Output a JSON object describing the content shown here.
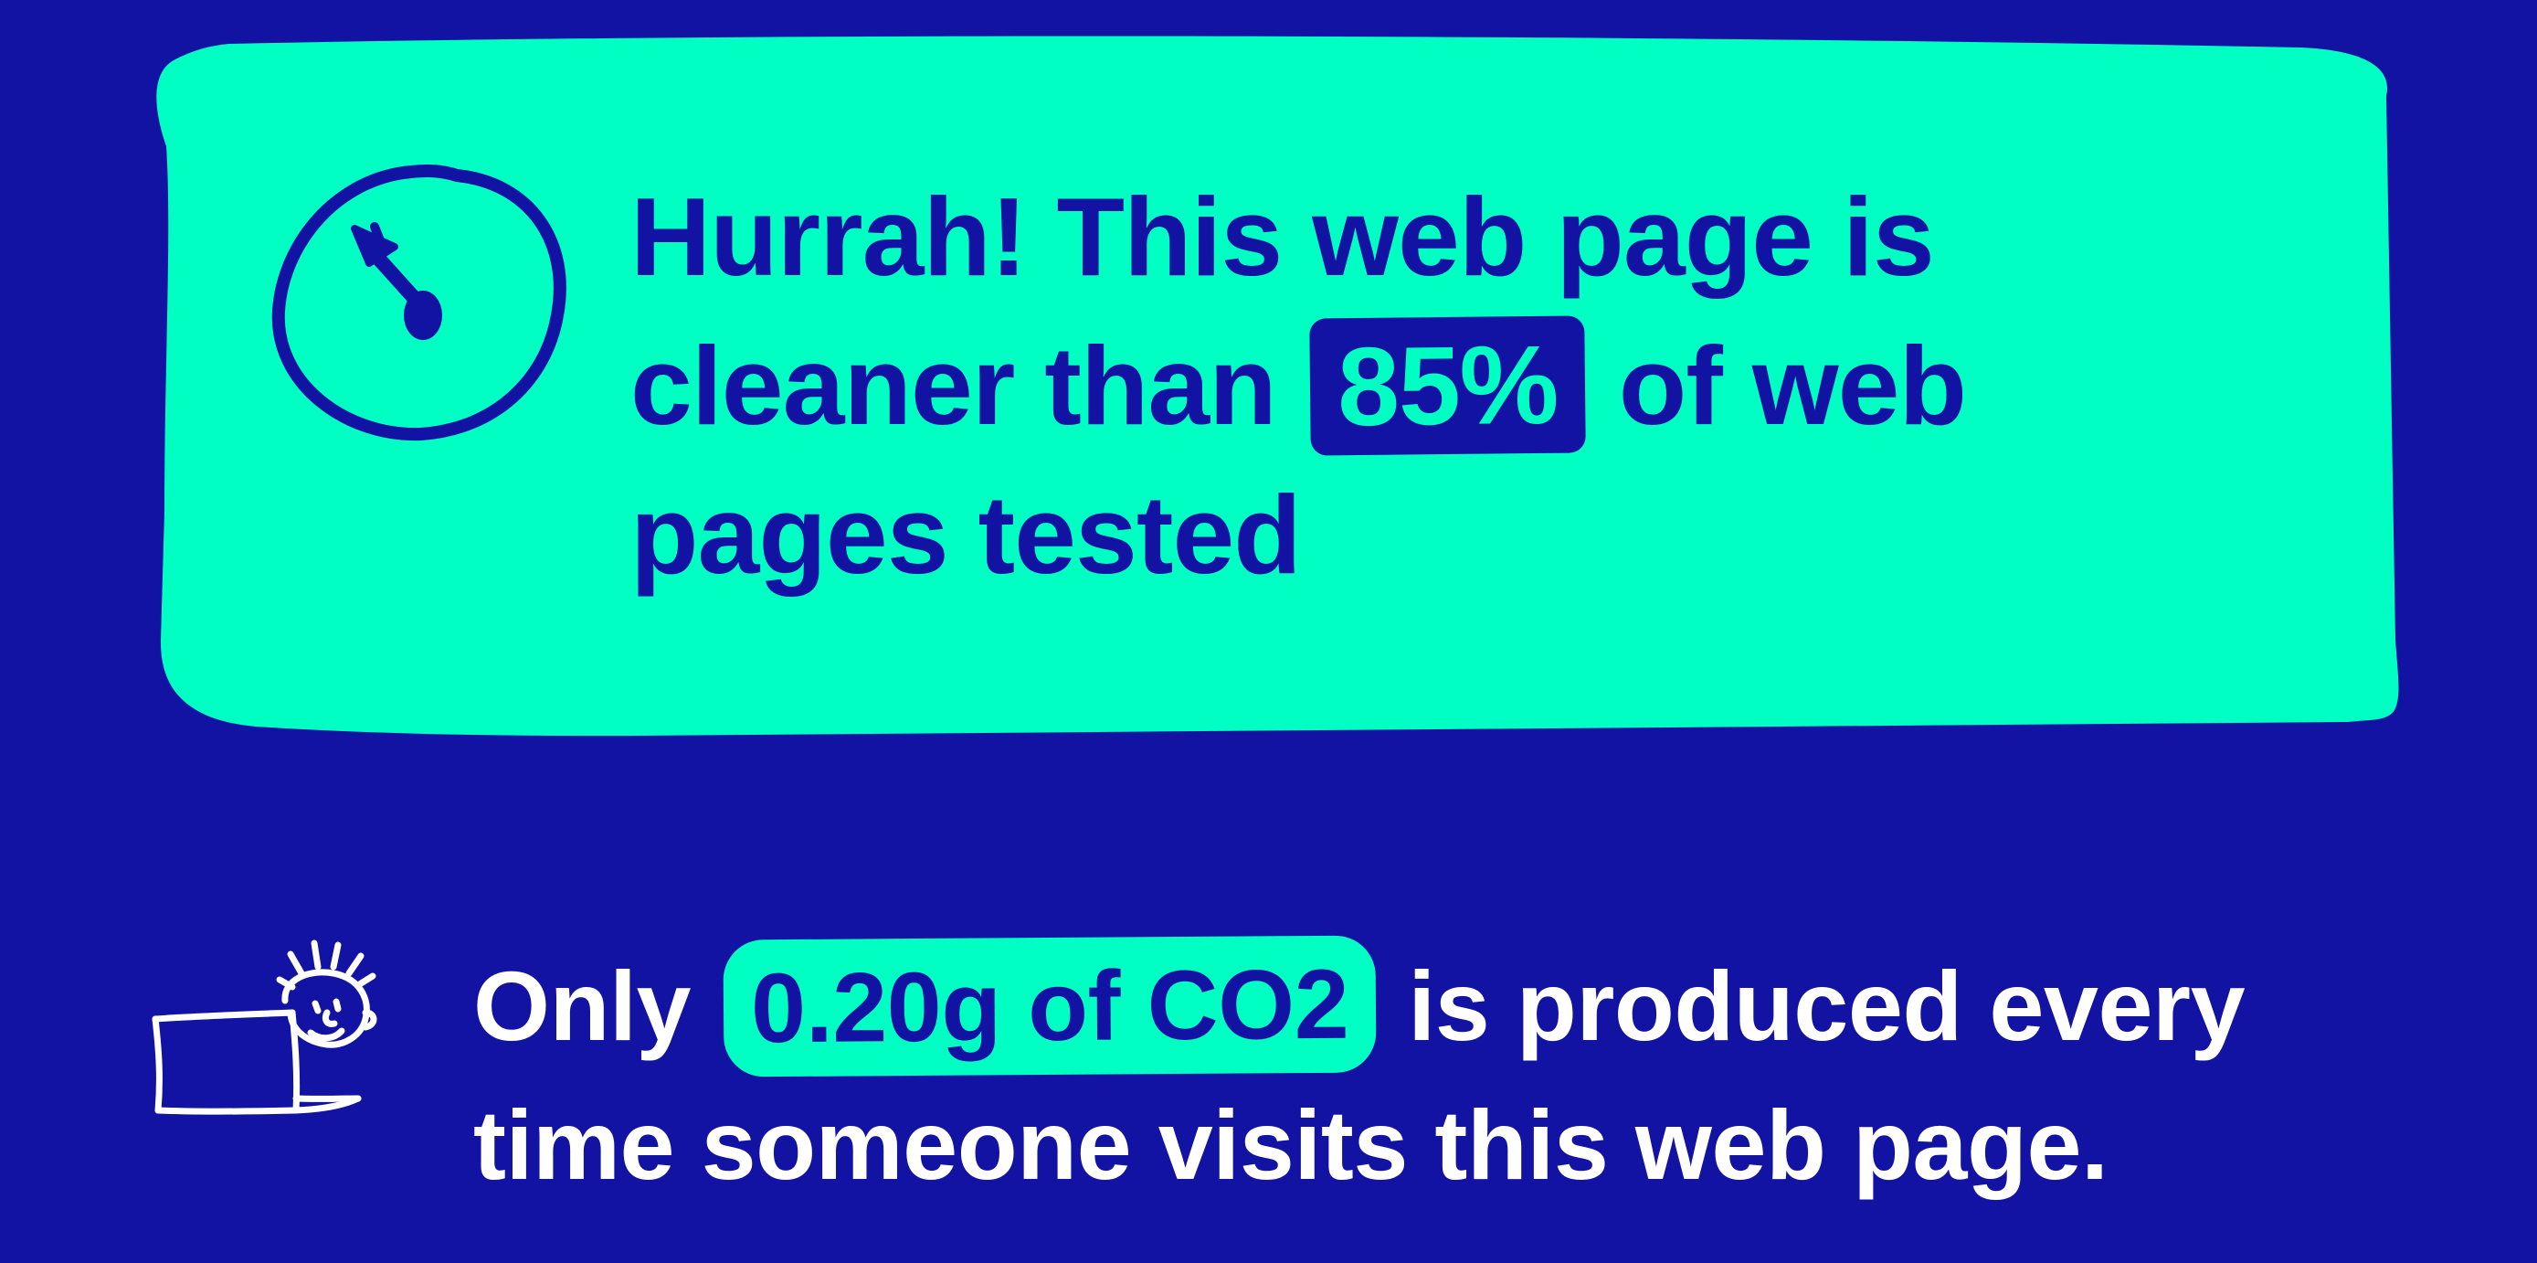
{
  "colors": {
    "background": "#1212a3",
    "card": "#00ffc3",
    "text_light": "#ffffff"
  },
  "rating": {
    "icon": "gauge-icon",
    "text_before": "Hurrah! This web page is cleaner than",
    "percent": "85%",
    "text_after": "of web pages tested"
  },
  "emissions": {
    "icon": "person-at-laptop-icon",
    "text_before": "Only",
    "amount": "0.20g of CO2",
    "text_after": "is produced every time someone visits this web page."
  }
}
